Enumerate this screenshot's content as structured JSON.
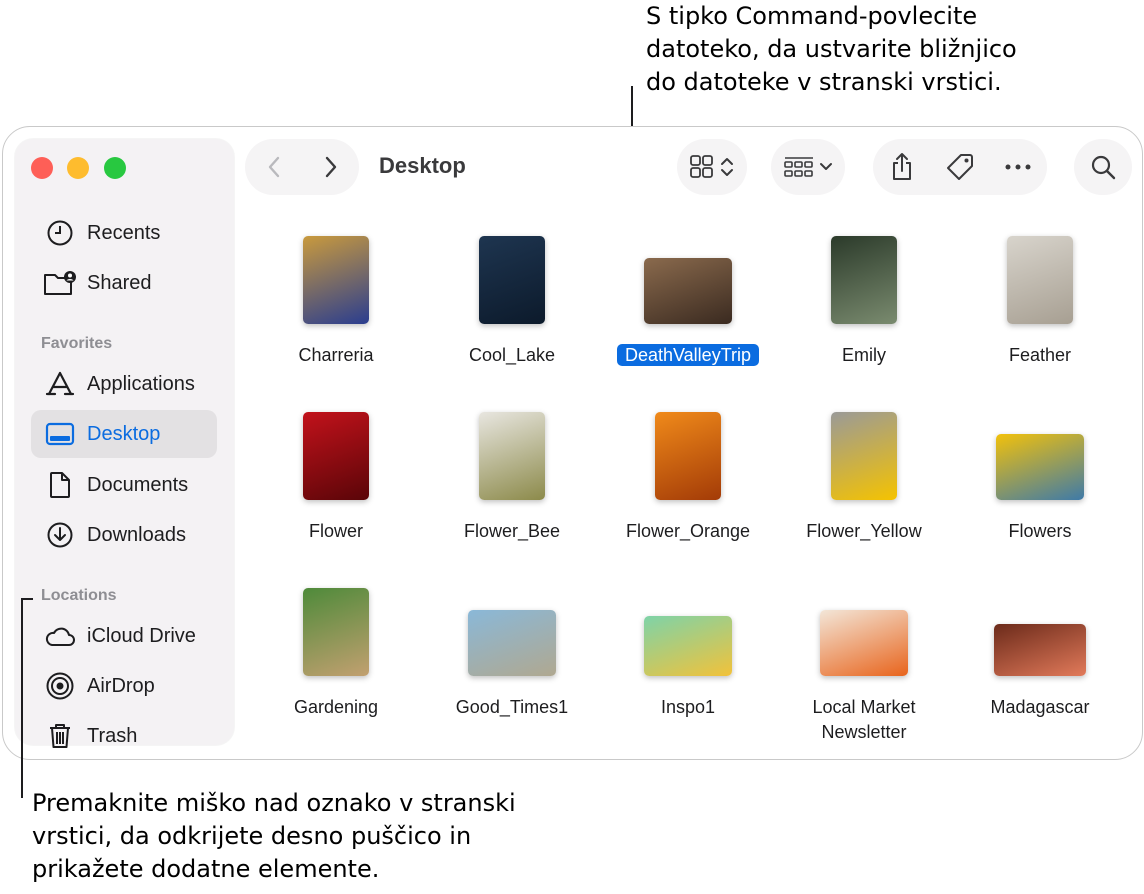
{
  "callouts": {
    "top": [
      "S tipko Command-povlecite",
      "datoteko, da ustvarite bližnjico",
      "do datoteke v stranski vrstici."
    ],
    "bottom": [
      "Premaknite miško nad oznako v stranski",
      "vrstici, da odkrijete desno puščico in",
      "prikažete dodatne elemente."
    ]
  },
  "window": {
    "title": "Desktop"
  },
  "sidebar": {
    "top_items": [
      {
        "label": "Recents",
        "icon": "clock-icon"
      },
      {
        "label": "Shared",
        "icon": "shared-folder-icon"
      }
    ],
    "favorites_heading": "Favorites",
    "favorites": [
      {
        "label": "Applications",
        "icon": "applications-icon"
      },
      {
        "label": "Desktop",
        "icon": "desktop-icon",
        "active": true
      },
      {
        "label": "Documents",
        "icon": "document-icon"
      },
      {
        "label": "Downloads",
        "icon": "download-icon"
      }
    ],
    "locations_heading": "Locations",
    "locations": [
      {
        "label": "iCloud Drive",
        "icon": "cloud-icon"
      },
      {
        "label": "AirDrop",
        "icon": "airdrop-icon"
      },
      {
        "label": "Trash",
        "icon": "trash-icon"
      }
    ]
  },
  "files": [
    {
      "name": "Charreria",
      "colors": [
        "#c99a3d",
        "#2a3d8f"
      ]
    },
    {
      "name": "Cool_Lake",
      "colors": [
        "#1e3550",
        "#0c1a2b"
      ]
    },
    {
      "name": "DeathValleyTrip",
      "colors": [
        "#8a6a4d",
        "#3a2a20"
      ],
      "selected": true
    },
    {
      "name": "Emily",
      "colors": [
        "#2b3a2a",
        "#7a8b6f"
      ]
    },
    {
      "name": "Feather",
      "colors": [
        "#d8d4cc",
        "#a79f92"
      ]
    },
    {
      "name": "Flower",
      "colors": [
        "#c2121b",
        "#5a0508"
      ]
    },
    {
      "name": "Flower_Bee",
      "colors": [
        "#e8e6e0",
        "#8c8a4a"
      ]
    },
    {
      "name": "Flower_Orange",
      "colors": [
        "#f08a1a",
        "#a33b07"
      ]
    },
    {
      "name": "Flower_Yellow",
      "colors": [
        "#9a9a98",
        "#f5c300"
      ]
    },
    {
      "name": "Flowers",
      "colors": [
        "#f2c10b",
        "#3e7aa8"
      ]
    },
    {
      "name": "Gardening",
      "colors": [
        "#4e8a3a",
        "#c2a070"
      ]
    },
    {
      "name": "Good_Times1",
      "colors": [
        "#8ab8d8",
        "#b0a890"
      ]
    },
    {
      "name": "Inspo1",
      "colors": [
        "#7ed3a8",
        "#f2c23a"
      ]
    },
    {
      "name": "Local Market Newsletter",
      "colors": [
        "#f3e6d8",
        "#e8641c"
      ]
    },
    {
      "name": "Madagascar",
      "colors": [
        "#6b2a1a",
        "#e27a5a"
      ]
    }
  ]
}
